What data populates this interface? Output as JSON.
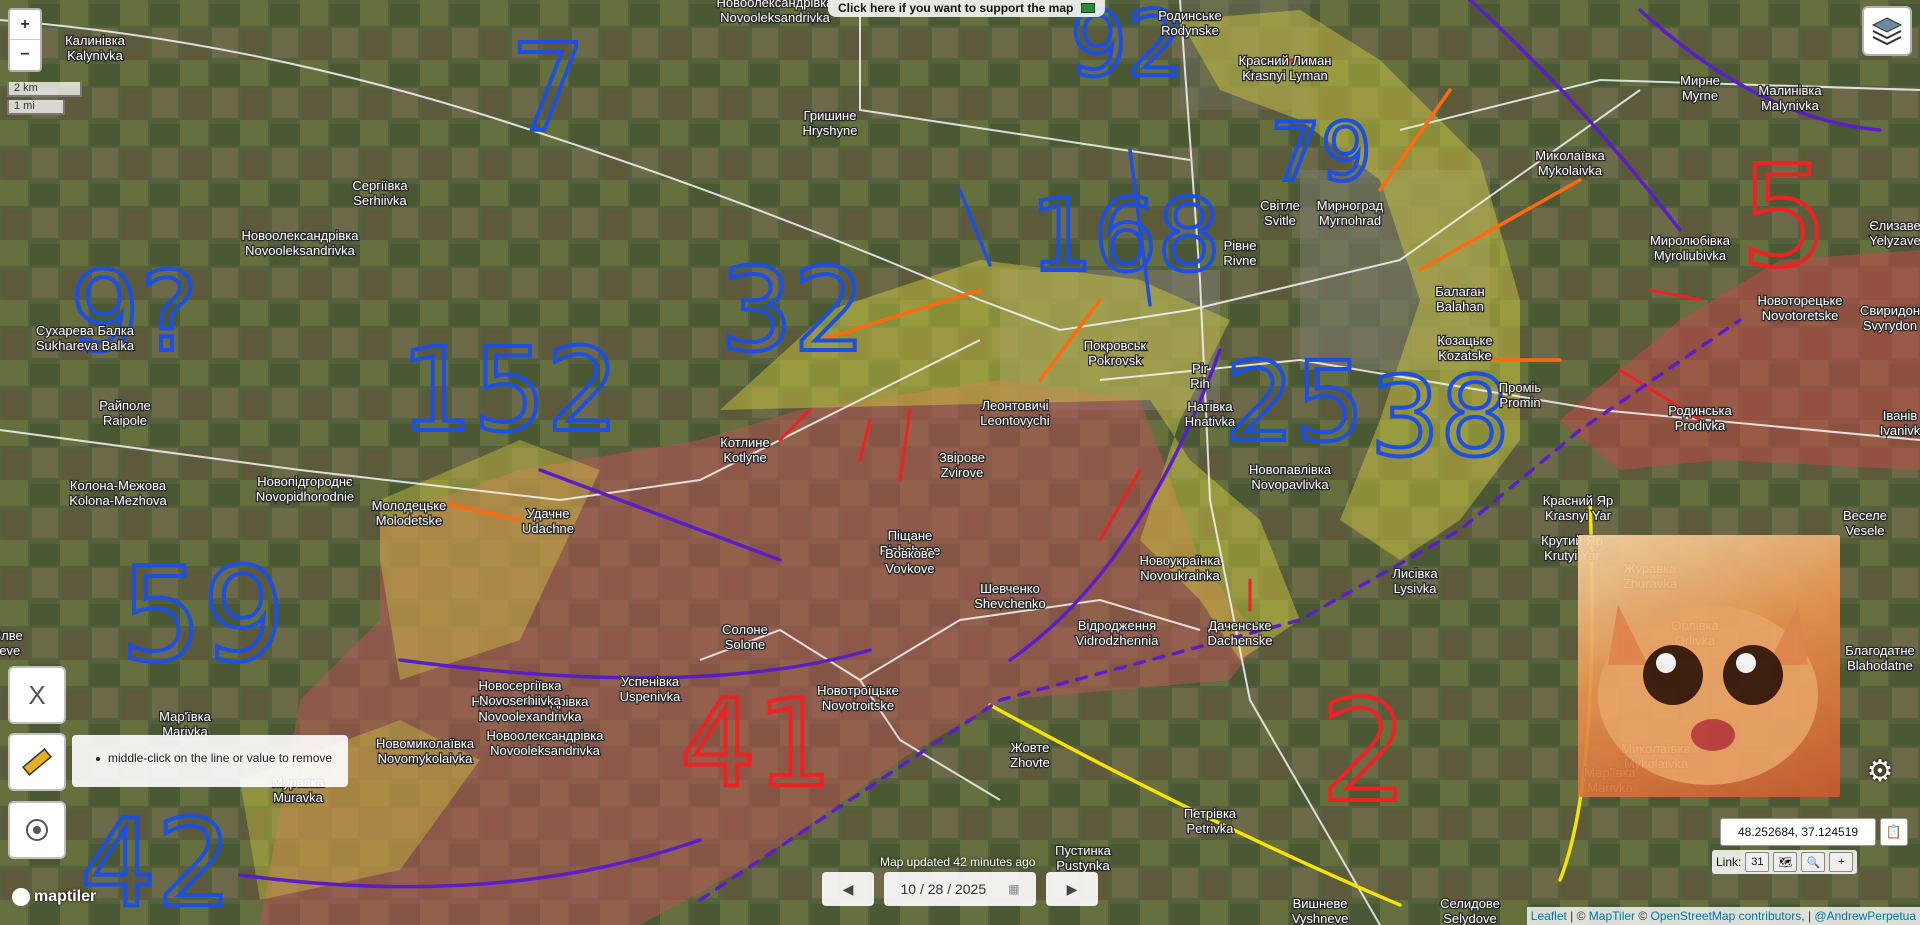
{
  "top_banner": {
    "support_text": "Click here if you want to support the map",
    "support_icon": "banknote-icon"
  },
  "zoom": {
    "in_label": "+",
    "out_label": "−"
  },
  "scale": {
    "km": "2 km",
    "mi": "1 mi"
  },
  "places": [
    {
      "ua": "Калинівка",
      "lat": "Kalynivka"
    },
    {
      "ua": "Новоолександрівка",
      "lat": "Novooleksandrivka"
    },
    {
      "ua": "Родинське",
      "lat": "Rodynske"
    },
    {
      "ua": "Гришине",
      "lat": "Hryshyne"
    },
    {
      "ua": "Красний Лиман",
      "lat": "Krasnyi Lyman"
    },
    {
      "ua": "Мирне",
      "lat": "Myrne"
    },
    {
      "ua": "Малинівка",
      "lat": "Malynivka"
    },
    {
      "ua": "Сергіївка",
      "lat": "Serhiivka"
    },
    {
      "ua": "Миколаївка",
      "lat": "Mykolaivka"
    },
    {
      "ua": "Світле",
      "lat": "Svitle"
    },
    {
      "ua": "Мирноград",
      "lat": "Myrnohrad"
    },
    {
      "ua": "Новоолександрівка",
      "lat": "Novooleksandrivka"
    },
    {
      "ua": "Миролюбівка",
      "lat": "Myroliubivka"
    },
    {
      "ua": "Єлизаве",
      "lat": "Yelyzave"
    },
    {
      "ua": "Рівне",
      "lat": "Rivne"
    },
    {
      "ua": "Балаган",
      "lat": "Balahan"
    },
    {
      "ua": "Новоторецьке",
      "lat": "Novotoretske"
    },
    {
      "ua": "Свиридон",
      "lat": "Svyrydon"
    },
    {
      "ua": "Сухарева Балка",
      "lat": "Sukhareva Balka"
    },
    {
      "ua": "Козацьке",
      "lat": "Kozatske"
    },
    {
      "ua": "Покровськ",
      "lat": "Pokrovsk"
    },
    {
      "ua": "Pir",
      "lat": "Rih"
    },
    {
      "ua": "Проміь",
      "lat": "Promin"
    },
    {
      "ua": "Райполе",
      "lat": "Raipole"
    },
    {
      "ua": "Котлине",
      "lat": "Kotlyne"
    },
    {
      "ua": "Леонтовичі",
      "lat": "Leontovychi"
    },
    {
      "ua": "Натівка",
      "lat": "Hnativka"
    },
    {
      "ua": "Родинська",
      "lat": "Prodivka"
    },
    {
      "ua": "Іванів",
      "lat": "Ivanivk"
    },
    {
      "ua": "Колона-Межова",
      "lat": "Kolona-Mezhova"
    },
    {
      "ua": "Новопідгороднє",
      "lat": "Novopidhorodnie"
    },
    {
      "ua": "Звірове",
      "lat": "Zvirove"
    },
    {
      "ua": "Новопавлівка",
      "lat": "Novopavlivka"
    },
    {
      "ua": "Молодецьке",
      "lat": "Molodetske"
    },
    {
      "ua": "Удачне",
      "lat": "Udachne"
    },
    {
      "ua": "Красний Яр",
      "lat": "Krasnyi Yar"
    },
    {
      "ua": "Веселе",
      "lat": "Vesele"
    },
    {
      "ua": "Піщане",
      "lat": "Pishchane"
    },
    {
      "ua": "Крутий Яр",
      "lat": "Krutyi Yar"
    },
    {
      "ua": "Вовкове",
      "lat": "Vovkove"
    },
    {
      "ua": "Новоукраїнка",
      "lat": "Novoukrainka"
    },
    {
      "ua": "Журавка",
      "lat": "Zhuravka"
    },
    {
      "ua": "Лисівка",
      "lat": "Lysivka"
    },
    {
      "ua": "Шевченко",
      "lat": "Shevchenko"
    },
    {
      "ua": "Відродження",
      "lat": "Vidrodzhennia"
    },
    {
      "ua": "Даченське",
      "lat": "Dachenske"
    },
    {
      "ua": "Орлівка",
      "lat": "Orlivka"
    },
    {
      "ua": "Благодатне",
      "lat": "Blahodatne"
    },
    {
      "ua": "Солоне",
      "lat": "Solone"
    },
    {
      "ua": "Новоолександрівка",
      "lat": "Novoolexandrivka"
    },
    {
      "ua": "Новосергіївка",
      "lat": "Novoserhiivka"
    },
    {
      "ua": "Успенівка",
      "lat": "Uspenivka"
    },
    {
      "ua": "Новотроїцьке",
      "lat": "Novotroitske"
    },
    {
      "ua": "Новоолександрівка",
      "lat": "Novooleksandrivka"
    },
    {
      "ua": "Мар'ївка",
      "lat": "Marivka"
    },
    {
      "ua": "Новомиколаївка",
      "lat": "Novomykolaivka"
    },
    {
      "ua": "Жовте",
      "lat": "Zhovte"
    },
    {
      "ua": "Миколаївка",
      "lat": "Mykolaivka"
    },
    {
      "ua": "Мар'ївка",
      "lat": "Marivka"
    },
    {
      "ua": "Муравка",
      "lat": "Muravka"
    },
    {
      "ua": "Петрівка",
      "lat": "Petrivka"
    },
    {
      "ua": "Пустинка",
      "lat": "Pustynka"
    },
    {
      "ua": "Вишневе",
      "lat": "Vyshneve"
    },
    {
      "ua": "Селидове",
      "lat": "Selydove"
    },
    {
      "ua": "Злве",
      "lat": "Ieve"
    }
  ],
  "hand_numbers": [
    "7",
    "92",
    "79",
    "168",
    "32",
    "152",
    "9?",
    "25",
    "38",
    "5",
    "59",
    "41",
    "42",
    "2"
  ],
  "left_tools": {
    "close_label": "X",
    "ruler_icon": "ruler-icon",
    "target_icon": "crosshair-icon"
  },
  "tooltip": {
    "text": "middle-click on the line or value to remove"
  },
  "footer": {
    "updated": "Map updated 42 minutes ago",
    "date": "10 / 28 / 2025",
    "prev_icon": "triangle-left-icon",
    "next_icon": "triangle-right-icon",
    "calendar_icon": "calendar-icon"
  },
  "coords": {
    "value": "48.252684, 37.124519",
    "link_label": "Link:",
    "date_icon_text": "31"
  },
  "attribution": {
    "leaflet": "Leaflet",
    "sep1": " | © ",
    "maptiler": "MapTiler",
    "sep2": " © ",
    "osm": "OpenStreetMap contributors",
    "sep3": ", | ",
    "author": "@AndrewPerpetua"
  },
  "logo": {
    "text": "maptiler"
  },
  "colors": {
    "red_zone": "#c85a5a",
    "yellow_zone": "#d8d040",
    "ink_blue": "#1d4fe0",
    "ink_purple": "#5a1ec8",
    "ink_red": "#ee2222",
    "ink_orange": "#ff6a10",
    "ink_yellow": "#f5e20a"
  }
}
